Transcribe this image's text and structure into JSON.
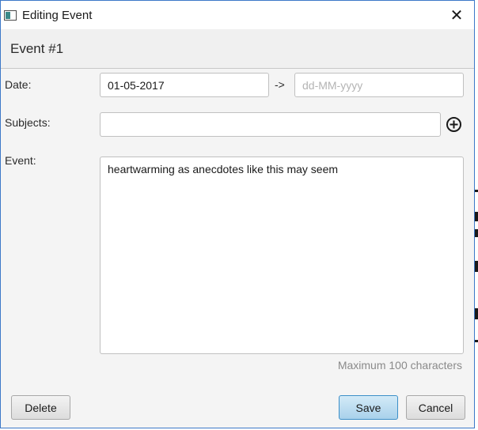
{
  "window": {
    "title": "Editing Event",
    "close_glyph": "✕"
  },
  "header": {
    "title": "Event #1"
  },
  "form": {
    "date_label": "Date:",
    "start_date_value": "01-05-2017",
    "range_arrow": "->",
    "end_date_placeholder": "dd-MM-yyyy",
    "subjects_label": "Subjects:",
    "subjects_value": "",
    "event_label": "Event:",
    "event_text": "heartwarming as anecdotes like this may seem",
    "max_hint": "Maximum 100 characters"
  },
  "buttons": {
    "delete_label": "Delete",
    "save_label": "Save",
    "cancel_label": "Cancel"
  },
  "colors": {
    "window_border": "#3c78c8",
    "primary_button": "#a9d1eb"
  }
}
